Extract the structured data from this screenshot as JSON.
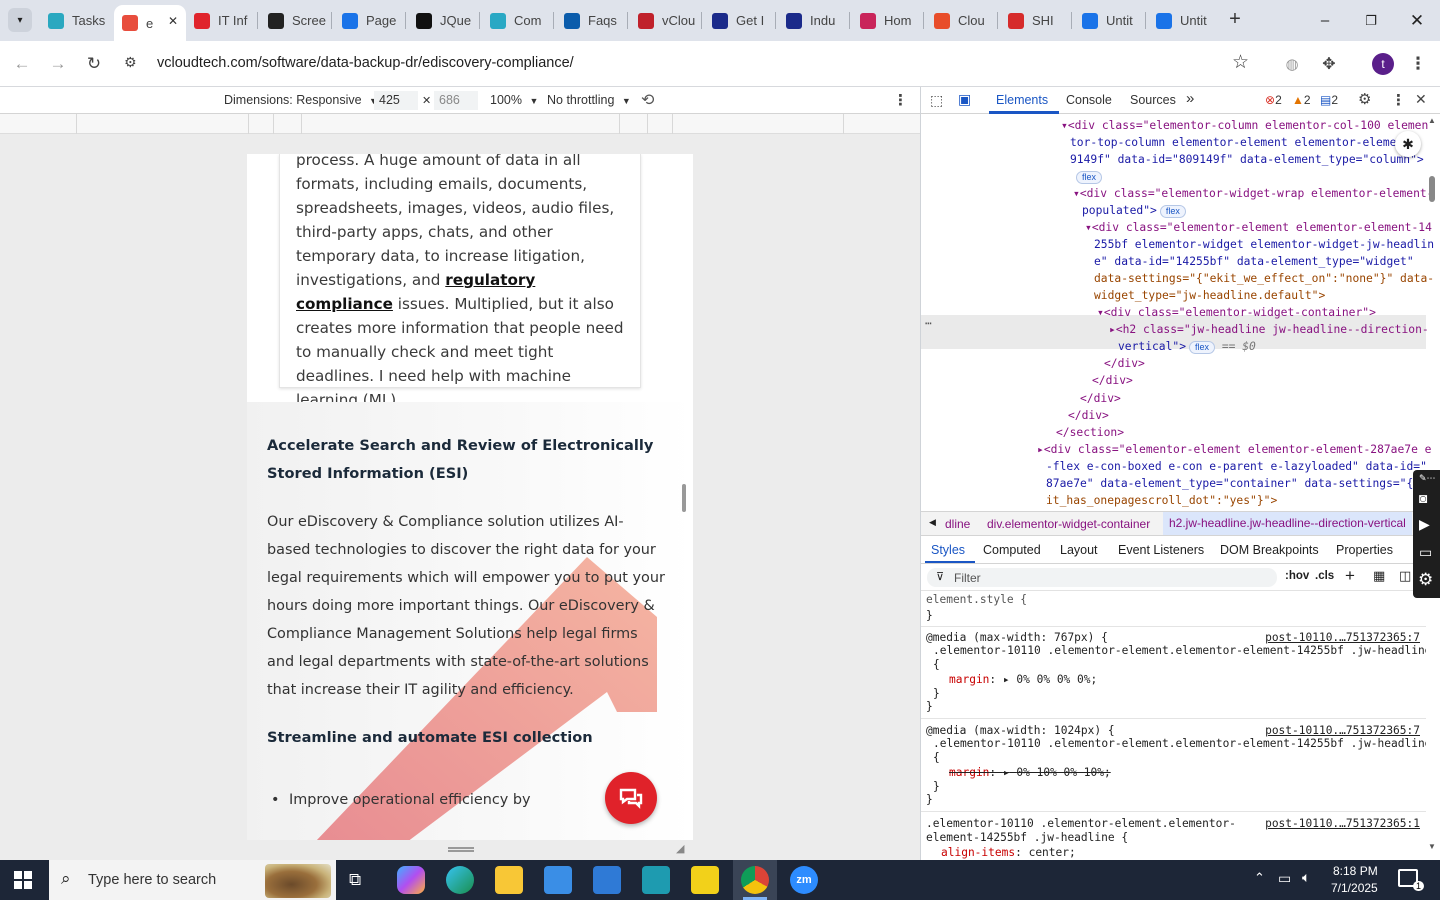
{
  "browser": {
    "tabs": [
      {
        "label": "Tasks",
        "color": "#2aa8c0"
      },
      {
        "label": "e",
        "color": "#e84d3d",
        "active": true
      },
      {
        "label": "IT Inf",
        "color": "#e0242c"
      },
      {
        "label": "Scree",
        "color": "#222222"
      },
      {
        "label": "Page",
        "color": "#1a73e8"
      },
      {
        "label": "JQue",
        "color": "#111111"
      },
      {
        "label": "Com",
        "color": "#29a8c4"
      },
      {
        "label": "Faqs",
        "color": "#0b5cab"
      },
      {
        "label": "vClou",
        "color": "#c0212b"
      },
      {
        "label": "Get I",
        "color": "#1b2a8a"
      },
      {
        "label": "Indu",
        "color": "#1b2a8a"
      },
      {
        "label": "Hom",
        "color": "#c9245a"
      },
      {
        "label": "Clou",
        "color": "#e84d2a"
      },
      {
        "label": "SHI",
        "color": "#d62b2b"
      },
      {
        "label": "Untit",
        "color": "#1a73e8"
      },
      {
        "label": "Untit",
        "color": "#1a73e8"
      }
    ],
    "url": "vcloudtech.com/software/data-backup-dr/ediscovery-compliance/",
    "profile_initial": "t"
  },
  "device_toolbar": {
    "dimensions_label": "Dimensions: Responsive",
    "width": "425",
    "height": "686",
    "zoom": "100%",
    "throttle": "No throttling"
  },
  "page": {
    "card_text_before": "process. A huge amount of data in all formats, including emails, documents, spreadsheets, images, videos, audio files, third-party apps, chats, and other temporary data, to increase litigation, investigations, and ",
    "card_link": "regulatory compliance",
    "card_text_after": " issues. Multiplied, but it also creates more information that people need to manually check and meet tight deadlines. I need help with machine learning (ML).",
    "heading1": "Accelerate Search and Review of Electronically Stored Information (ESI)",
    "paragraph": "Our eDiscovery & Compliance solution utilizes AI-based technologies to discover the right data for your legal requirements which will empower you to put your hours doing more important things. Our eDiscovery & Compliance Management Solutions help legal firms and legal departments with state-of-the-art solutions that increase their IT agility and efficiency.",
    "heading2": "Streamline and automate ESI collection",
    "bullet1": "Improve operational efficiency by"
  },
  "devtools": {
    "tabs": [
      "Elements",
      "Console",
      "Sources"
    ],
    "errors": "2",
    "warnings": "2",
    "info": "2",
    "breadcrumbs": [
      "dline",
      "div.elementor-widget-container",
      "h2.jw-headline.jw-headline--direction-vertical"
    ],
    "subtabs": [
      "Styles",
      "Computed",
      "Layout",
      "Event Listeners",
      "DOM Breakpoints",
      "Properties"
    ],
    "filter_placeholder": "Filter",
    "hov": ":hov",
    "cls": ".cls",
    "dom_lines": [
      "<div class=\"elementor-column elementor-col-100 elemen",
      "tor-top-column elementor-element elementor-elemen",
      "9149f\" data-id=\"809149f\" data-element_type=\"column\">",
      "<div class=\"elementor-widget-wrap elementor-element-",
      "populated\">",
      "<div class=\"elementor-element elementor-element-14",
      "255bf elementor-widget elementor-widget-jw-headlin",
      "e\" data-id=\"14255bf\" data-element_type=\"widget\"",
      "data-settings=\"{\"ekit_we_effect_on\":\"none\"}\" data-",
      "widget_type=\"jw-headline.default\">",
      "<div class=\"elementor-widget-container\">",
      "<h2 class=\"jw-headline jw-headline--direction-",
      "vertical\">",
      "</div>",
      "</div>",
      "</div>",
      "</div>",
      "</section>",
      "<div class=\"elementor-element elementor-element-287ae7e e",
      "-flex e-con-boxed e-con e-parent e-lazyloaded\" data-id=\"",
      "87ae7e\" data-element_type=\"container\" data-settings=\"{\"e",
      "it_has_onepagescroll_dot\":\"yes\"}\">"
    ],
    "selected_suffix": "== $0",
    "flex_badge": "flex",
    "styles": {
      "element_style": "element.style {",
      "close": "}",
      "media1": "@media (max-width: 767px) {",
      "selector": ".elementor-10110 .elementor-element.elementor-element-14255bf .jw-headline",
      "open": "{",
      "margin_prop": "margin",
      "margin1": "0% 0% 0% 0%;",
      "media2": "@media (max-width: 1024px) {",
      "margin2": "0% 10% 0% 10%;",
      "selector3a": ".elementor-10110 .elementor-element.elementor-",
      "selector3b": "element-14255bf .jw-headline {",
      "align_prop": "align-items",
      "align_val": "center;",
      "src1": "post-10110.…751372365:7",
      "src2": "post-10110.…751372365:7",
      "src3": "post-10110.…751372365:1"
    }
  },
  "taskbar": {
    "search_placeholder": "Type here to search",
    "time": "8:18 PM",
    "date": "7/1/2025",
    "notif_count": "1"
  }
}
